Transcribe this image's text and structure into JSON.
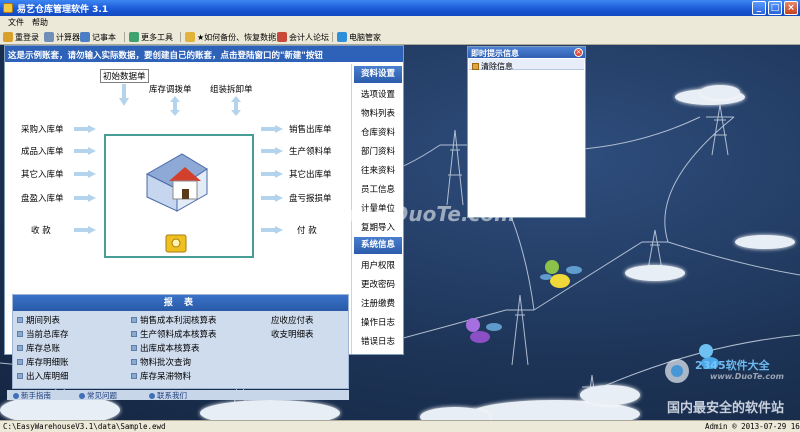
{
  "window": {
    "title": "易艺仓库管理软件 3.1",
    "buttons": [
      "_",
      "□",
      "×"
    ]
  },
  "menu": [
    "文件",
    "帮助"
  ],
  "toolbar": [
    {
      "label": "重登录",
      "icon": "key-icon"
    },
    {
      "label": "计算器",
      "icon": "calculator-icon"
    },
    {
      "label": "记事本",
      "icon": "notepad-icon"
    },
    {
      "label": "更多工具",
      "icon": "tools-icon"
    },
    {
      "label": "★如何备份、恢复数据",
      "icon": "backup-icon"
    },
    {
      "label": "会计人论坛",
      "icon": "forum-icon"
    },
    {
      "label": "电脑管家",
      "icon": "pc-manager-icon"
    }
  ],
  "banner": "这是示例账套，请勿输入实际数据，要创建自己的账套，点击登陆窗口的\"新建\"按钮",
  "flow": {
    "top_left": "初始数据单",
    "top_mid": "库存调拨单",
    "top_right": "组装拆卸单",
    "left": [
      "采购入库单",
      "成品入库单",
      "其它入库单",
      "盘盈入库单",
      "收  款"
    ],
    "right": [
      "销售出库单",
      "生产领料单",
      "其它出库单",
      "盘亏报损单",
      "付  款"
    ]
  },
  "reports": {
    "header": "报 表",
    "items": [
      [
        "期间列表",
        "销售成本利润核算表",
        "应收应付表"
      ],
      [
        "当前总库存",
        "生产领料成本核算表",
        "收支明细表"
      ],
      [
        "库存总账",
        "出库成本核算表",
        ""
      ],
      [
        "库存明细账",
        "物料批次查询",
        ""
      ],
      [
        "出入库明细",
        "库存呆滞物料",
        ""
      ]
    ]
  },
  "bottom_links": [
    "新手指南",
    "常见问题",
    "联系我们"
  ],
  "sidebar": {
    "section1": "资料设置",
    "items1": [
      "选项设置",
      "物料列表",
      "仓库资料",
      "部门资料",
      "往来资料",
      "员工信息",
      "计量单位",
      "复期导入"
    ],
    "section2": "系统信息",
    "items2": [
      "用户权限",
      "更改密码",
      "注册缴费",
      "操作日志",
      "错误日志"
    ]
  },
  "notice": {
    "title": "即时提示信息",
    "close": "×",
    "clear_button": "清除信息"
  },
  "status": {
    "path": "C:\\EasyWarehouseV3.1\\data\\Sample.ewd",
    "user": "Admin ® 2013-07-29 16:20"
  },
  "watermarks": {
    "center": "www.DuoTe.com",
    "corner_top": "2345软件大全",
    "corner_url": "www.DuoTe.com",
    "corner_bottom": "国内最安全的软件站"
  },
  "colors": {
    "banner_bg": "#2e62b8",
    "accent": "#2c5cab",
    "desktop_bg": "#1d3457"
  }
}
